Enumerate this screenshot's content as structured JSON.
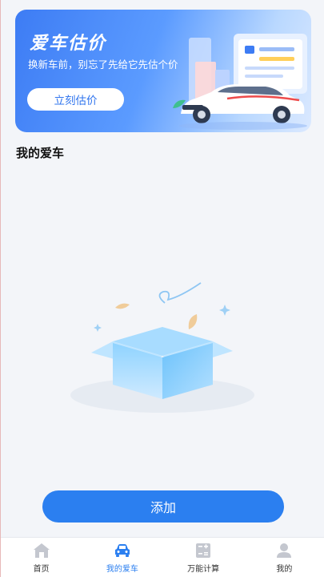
{
  "banner": {
    "title": "爱车估价",
    "subtitle": "换新车前，别忘了先给它先估个价",
    "button_label": "立刻估价"
  },
  "section": {
    "title": "我的爱车"
  },
  "actions": {
    "add_label": "添加"
  },
  "tabbar": {
    "active_index": 1,
    "items": [
      {
        "label": "首页",
        "icon": "home-icon"
      },
      {
        "label": "我的爱车",
        "icon": "car-icon"
      },
      {
        "label": "万能计算",
        "icon": "calculator-icon"
      },
      {
        "label": "我的",
        "icon": "user-icon"
      }
    ]
  },
  "colors": {
    "accent": "#2b7ff0",
    "background": "#f3f5f9",
    "inactive_icon": "#c4c7cf"
  }
}
